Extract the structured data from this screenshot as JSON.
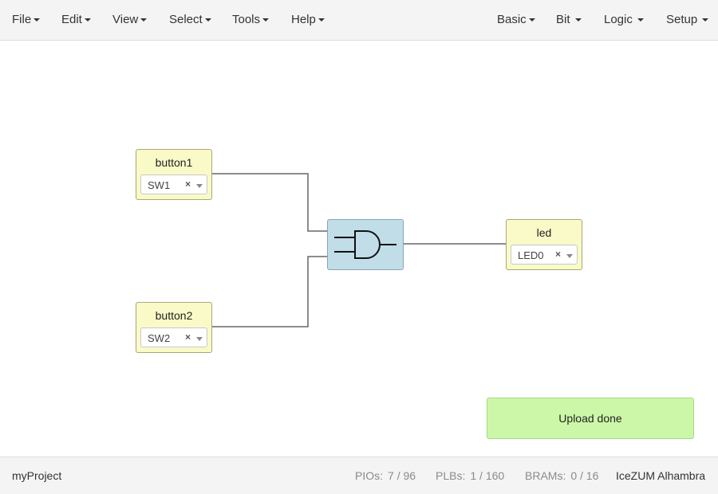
{
  "menubar": {
    "left": [
      {
        "label": "File"
      },
      {
        "label": "Edit"
      },
      {
        "label": "View"
      },
      {
        "label": "Select"
      },
      {
        "label": "Tools"
      },
      {
        "label": "Help"
      }
    ],
    "right": [
      {
        "label": "Basic"
      },
      {
        "label": "Bit"
      },
      {
        "label": "Logic"
      },
      {
        "label": "Setup"
      }
    ]
  },
  "canvas": {
    "inputs": [
      {
        "name": "button1",
        "pin": "SW1"
      },
      {
        "name": "button2",
        "pin": "SW2"
      }
    ],
    "gate": {
      "type": "AND",
      "icon": "and-gate-icon"
    },
    "outputs": [
      {
        "name": "led",
        "pin": "LED0"
      }
    ],
    "wire_color": "#666666"
  },
  "notification": {
    "text": "Upload done",
    "color": "#ccf7a8"
  },
  "footer": {
    "project_name": "myProject",
    "stats": [
      {
        "label": "PIOs:",
        "value": "7 / 96"
      },
      {
        "label": "PLBs:",
        "value": "1 / 160"
      },
      {
        "label": "BRAMs:",
        "value": "0 / 16"
      }
    ],
    "board": "IceZUM Alhambra"
  },
  "colors": {
    "io_block": "#fafac8",
    "gate_block": "#c0dde8",
    "bar_background": "#f4f4f4"
  }
}
